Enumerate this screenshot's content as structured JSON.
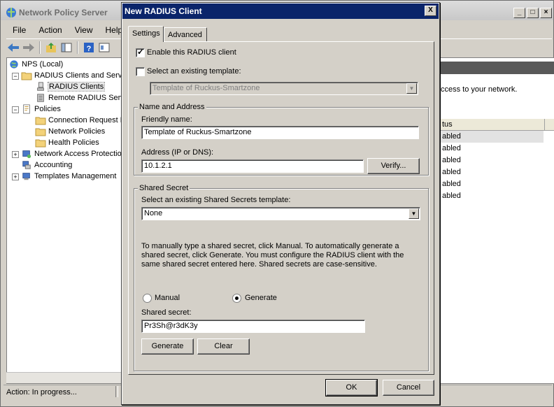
{
  "mmc": {
    "title": "Network Policy Server",
    "menu": [
      "File",
      "Action",
      "View",
      "Help"
    ],
    "tree": [
      {
        "label": "NPS (Local)",
        "icon": "globe-icon"
      },
      {
        "label": "RADIUS Clients and Servers",
        "icon": "folder-icon"
      },
      {
        "label": "RADIUS Clients",
        "icon": "clients-icon"
      },
      {
        "label": "Remote RADIUS Server Groups",
        "icon": "server-group-icon"
      },
      {
        "label": "Policies",
        "icon": "policies-icon"
      },
      {
        "label": "Connection Request Policies",
        "icon": "folder-icon"
      },
      {
        "label": "Network Policies",
        "icon": "folder-icon"
      },
      {
        "label": "Health Policies",
        "icon": "folder-icon"
      },
      {
        "label": "Network Access Protection",
        "icon": "nap-icon"
      },
      {
        "label": "Accounting",
        "icon": "accounting-icon"
      },
      {
        "label": "Templates Management",
        "icon": "templates-icon"
      }
    ],
    "right_description": "ccess to your network.",
    "right_column_header": "tus",
    "right_rows": [
      "abled",
      "abled",
      "abled",
      "abled",
      "abled",
      "abled"
    ],
    "status_text": "Action:  In progress..."
  },
  "dialog": {
    "title": "New RADIUS Client",
    "close_glyph": "X",
    "tabs": [
      "Settings",
      "Advanced"
    ],
    "enable_client_label": "Enable this RADIUS client",
    "enable_client_checked": true,
    "select_template_label": "Select an existing template:",
    "select_template_checked": false,
    "template_value": "Template of Ruckus-Smartzone",
    "name_address": {
      "group_title": "Name and Address",
      "friendly_name_label": "Friendly name:",
      "friendly_name_value": "Template of Ruckus-Smartzone",
      "address_label": "Address (IP or DNS):",
      "address_value": "10.1.2.1",
      "verify_button": "Verify..."
    },
    "shared_secret": {
      "group_title": "Shared Secret",
      "template_label": "Select an existing Shared Secrets template:",
      "template_value": "None",
      "instructions": "To manually type a shared secret, click Manual. To automatically generate a shared secret, click Generate. You must configure the RADIUS client with the same shared secret entered here. Shared secrets are case-sensitive.",
      "manual_label": "Manual",
      "generate_label": "Generate",
      "selected_option": "Generate",
      "secret_label": "Shared secret:",
      "secret_value": "Pr3Sh@r3dK3y",
      "generate_button": "Generate",
      "clear_button": "Clear"
    },
    "ok_button": "OK",
    "cancel_button": "Cancel"
  }
}
